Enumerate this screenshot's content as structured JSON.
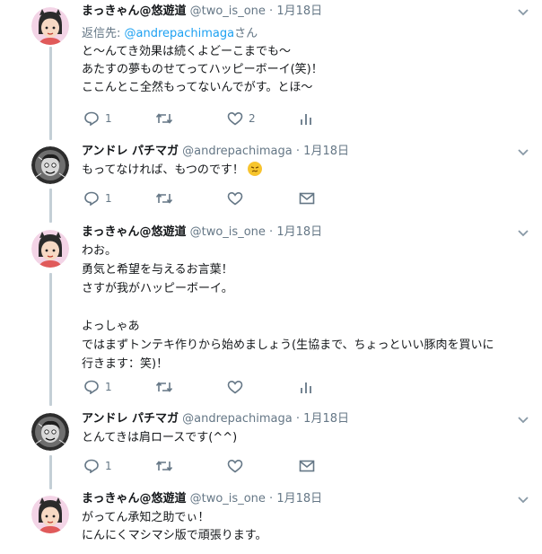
{
  "tweets": [
    {
      "name": "まっきゃん@悠遊道",
      "handle": "@two_is_one",
      "dot": "·",
      "date": "1月18日",
      "reply_prefix": "返信先: ",
      "reply_mention": "@andrepachimaga",
      "reply_suffix": "さん",
      "lines": [
        "と〜んてき効果は続くよどーこまでも〜",
        "あたすの夢ものせてってハッピーボーイ(笑)！",
        "ここんとこ全然もってないんでがす。とほ〜"
      ],
      "reply_count": "1",
      "like_count": "2",
      "last_action_icon": "analytics-icon"
    },
    {
      "name": "アンドレ パチマガ",
      "handle": "@andrepachimaga",
      "dot": "·",
      "date": "1月18日",
      "lines": [
        "もってなければ、もつのです！"
      ],
      "emoji_icon": "angry-face-emoji-icon",
      "reply_count": "1",
      "like_count": "",
      "last_action_icon": "envelope-icon"
    },
    {
      "name": "まっきゃん@悠遊道",
      "handle": "@two_is_one",
      "dot": "·",
      "date": "1月18日",
      "lines": [
        "わお。",
        "勇気と希望を与えるお言葉！",
        "さすが我がハッピーボーイ。",
        "",
        "よっしゃあ",
        "ではまずトンテキ作りから始めましょう(生協まで、ちょっといい豚肉を買いに",
        "行きます：笑)！"
      ],
      "reply_count": "1",
      "like_count": "",
      "last_action_icon": "analytics-icon"
    },
    {
      "name": "アンドレ パチマガ",
      "handle": "@andrepachimaga",
      "dot": "·",
      "date": "1月18日",
      "lines": [
        "とんてきは肩ロースです(^^)"
      ],
      "reply_count": "1",
      "like_count": "",
      "last_action_icon": "envelope-icon"
    },
    {
      "name": "まっきゃん@悠遊道",
      "handle": "@two_is_one",
      "dot": "·",
      "date": "1月18日",
      "lines": [
        "がってん承知之助でぃ！",
        "にんにくマシマシ版で頑張ります。"
      ]
    }
  ],
  "colors": {
    "text": "#14171a",
    "muted": "#657786",
    "link": "#1da1f2",
    "thread_line": "#c4cfd6"
  }
}
